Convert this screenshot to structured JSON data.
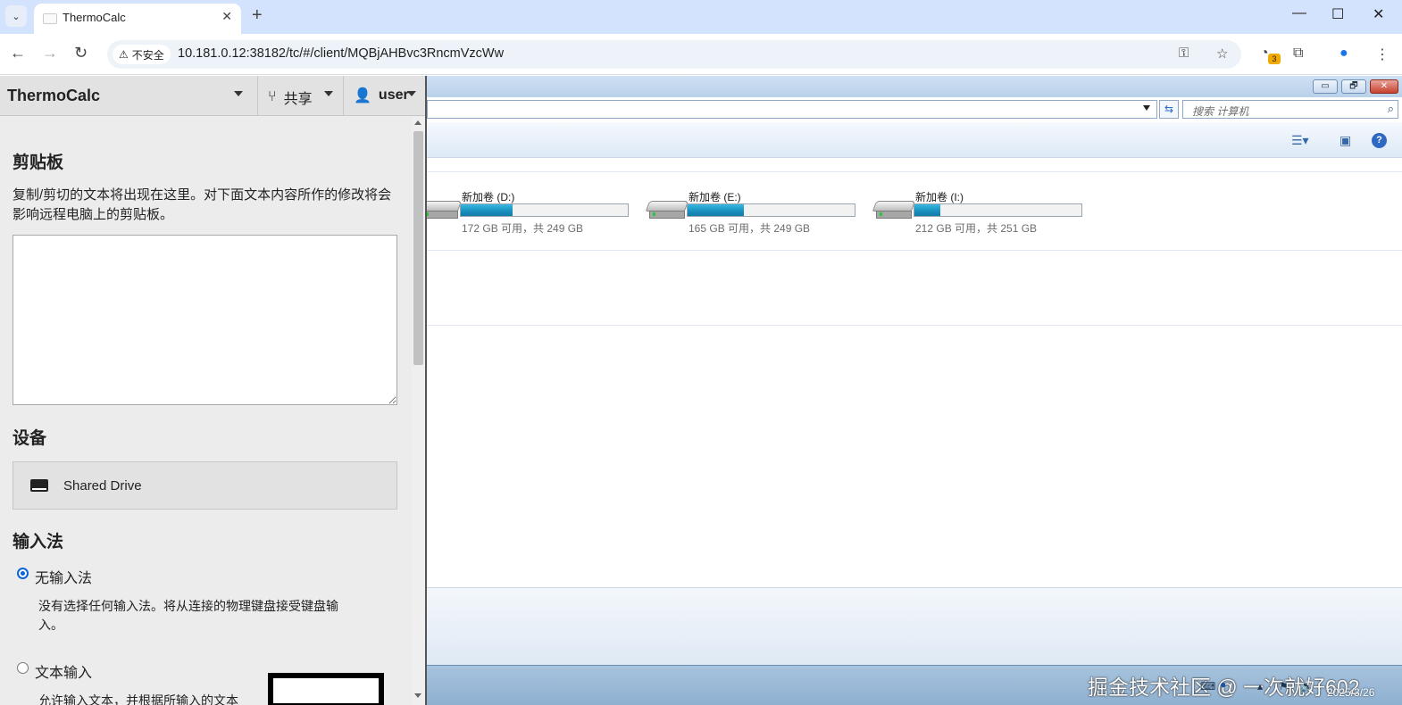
{
  "browser": {
    "tab_title": "ThermoCalc",
    "tab_search_icon": "chevron-down-icon",
    "new_tab_icon": "+",
    "security_label": "不安全",
    "url": "10.181.0.12:38182/tc/#/client/MQBjAHBvc3RncmVzcWw",
    "extension_badge": "3"
  },
  "panel": {
    "title": "ThermoCalc",
    "share_label": "共享",
    "user_label": "user",
    "clipboard": {
      "heading": "剪贴板",
      "description": "复制/剪切的文本将出现在这里。对下面文本内容所作的修改将会影响远程电脑上的剪贴板。",
      "value": ""
    },
    "devices": {
      "heading": "设备",
      "items": [
        {
          "label": "Shared Drive",
          "icon": "drive-icon"
        }
      ]
    },
    "input_method": {
      "heading": "输入法",
      "options": [
        {
          "label": "无输入法",
          "selected": true,
          "description": "没有选择任何输入法。将从连接的物理键盘接受键盘输入。"
        },
        {
          "label": "文本输入",
          "selected": false,
          "description": "允许输入文本，并根据所输入的文本"
        }
      ]
    }
  },
  "remote": {
    "search_placeholder": "搜索 计算机",
    "window_buttons": [
      "▭",
      "🗗",
      "✕"
    ],
    "drives": [
      {
        "name": "新加卷 (D:)",
        "free_text": "172 GB 可用，共 249 GB",
        "used_fraction": 0.309
      },
      {
        "name": "新加卷 (E:)",
        "free_text": "165 GB 可用，共 249 GB",
        "used_fraction": 0.337
      },
      {
        "name": "新加卷 (I:)",
        "free_text": "212 GB 可用，共 251 GB",
        "used_fraction": 0.155
      }
    ],
    "taskbar": {
      "clock_date": "2025/3/26"
    },
    "watermark": "掘金技术社区 @ 一次就好602"
  },
  "colors": {
    "tabbar": "#d3e3fd",
    "panel_bg": "#ececec",
    "drive_fill": "#1a91c1",
    "radio_accent": "#0a66d8"
  }
}
